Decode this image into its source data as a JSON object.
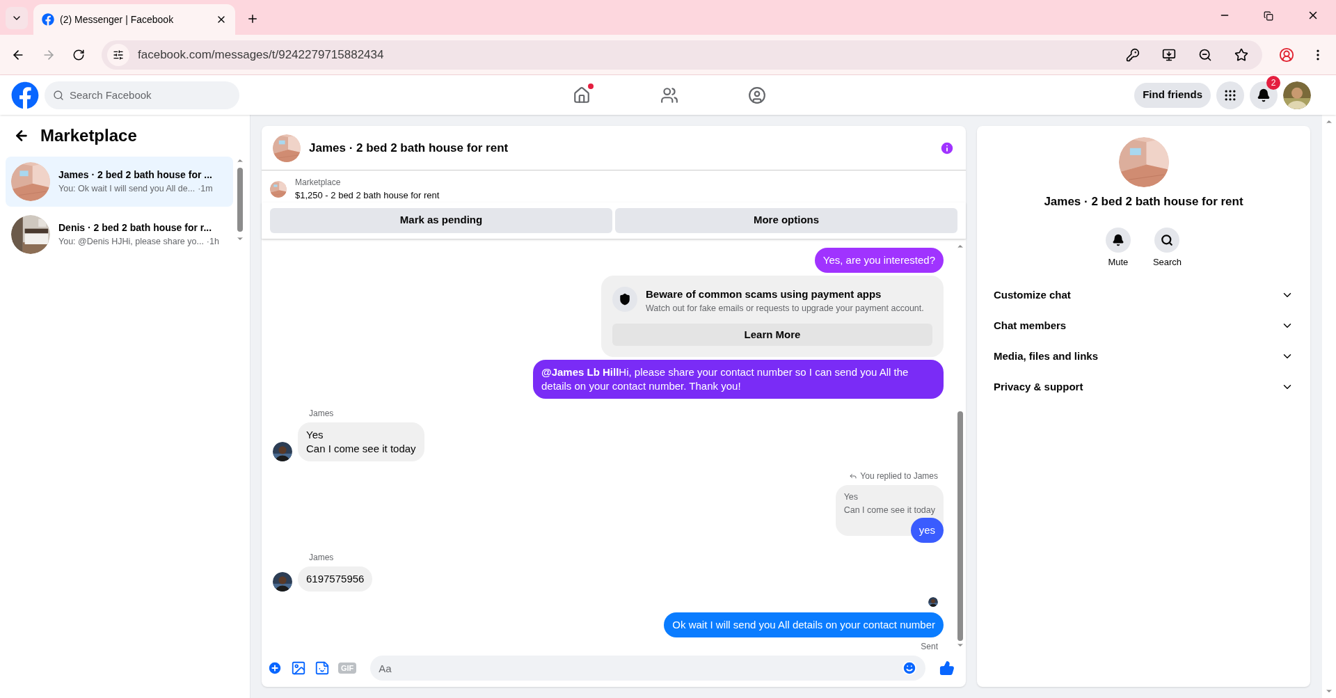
{
  "browser": {
    "tab_title": "(2) Messenger | Facebook",
    "address": "facebook.com/messages/t/9242279715882434"
  },
  "header": {
    "search_placeholder": "Search Facebook",
    "find_friends": "Find friends",
    "notification_count": "2"
  },
  "sidebar": {
    "title": "Marketplace",
    "conversations": [
      {
        "title": "James · 2 bed 2 bath house for ...",
        "preview": "You: Ok wait I will send you All de...",
        "time": "·1m",
        "selected": true
      },
      {
        "title": "Denis · 2 bed 2 bath house for r...",
        "preview": "You: @Denis HJHi, please share yo...",
        "time": "·1h",
        "selected": false
      }
    ]
  },
  "chat": {
    "title": "James · 2 bed 2 bath house for rent",
    "listing": {
      "source": "Marketplace",
      "summary": "$1,250 - 2 bed 2 bath house for rent"
    },
    "actions": [
      "Mark as pending",
      "More options"
    ],
    "messages": [
      {
        "kind": "sent",
        "text": "Yes, are you interested?",
        "color": "#a033ff"
      },
      {
        "kind": "notice",
        "title": "Beware of common scams using payment apps",
        "body": "Watch out for fake emails or requests to upgrade your payment account.",
        "button": "Learn More"
      },
      {
        "kind": "sent",
        "text": "**@James Lb Hill**Hi, please share your contact number so I can send you All the details on your contact number. Thank you!",
        "color": "#7a2cf6"
      },
      {
        "kind": "received",
        "sender": "James",
        "text": "Yes\nCan I come see it today"
      },
      {
        "kind": "reply",
        "caption": "You replied to James",
        "quoted": "Yes\nCan I come see it today",
        "text": "yes",
        "color": "#3a5cfe"
      },
      {
        "kind": "received",
        "sender": "James",
        "text": "6197575956"
      },
      {
        "kind": "sent",
        "text": "Ok wait I will send you All details on your contact number",
        "color": "#0a7cff",
        "seen": true,
        "status": "Sent"
      }
    ],
    "composer": {
      "placeholder": "Aa",
      "gif": "GIF"
    }
  },
  "details": {
    "title": "James · 2 bed 2 bath house for rent",
    "actions": [
      {
        "kind": "mute",
        "label": "Mute"
      },
      {
        "kind": "search",
        "label": "Search"
      }
    ],
    "sections": [
      {
        "label": "Customize chat",
        "expanded": false
      },
      {
        "label": "Chat members",
        "expanded": false
      },
      {
        "label": "Media, files and links",
        "expanded": false
      },
      {
        "label": "Privacy & support",
        "expanded": false
      }
    ]
  }
}
